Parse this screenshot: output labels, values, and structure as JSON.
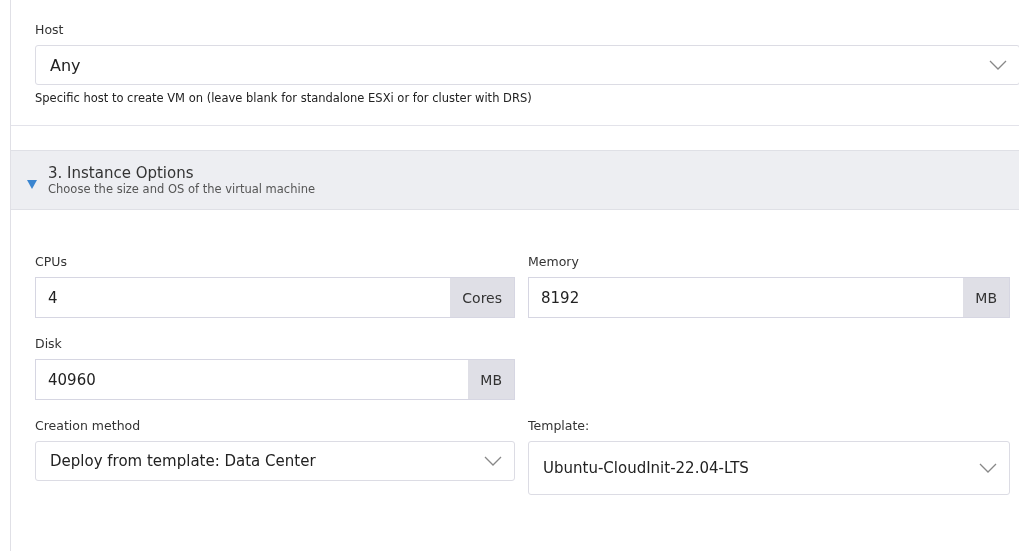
{
  "host": {
    "label": "Host",
    "value": "Any",
    "help": "Specific host to create VM on (leave blank for standalone ESXi or for cluster with DRS)"
  },
  "section": {
    "title": "3. Instance Options",
    "subtitle": "Choose the size and OS of the virtual machine",
    "expanded": true
  },
  "fields": [
    {
      "label": "CPUs",
      "value": "4",
      "unit": "Cores"
    },
    {
      "label": "Memory",
      "value": "8192",
      "unit": "MB"
    },
    {
      "label": "Disk",
      "value": "40960",
      "unit": "MB"
    }
  ],
  "selects": [
    {
      "label": "Creation method",
      "value": "Deploy from template: Data Center"
    },
    {
      "label": "Template:",
      "value": "Ubuntu-CloudInit-22.04-LTS"
    }
  ]
}
